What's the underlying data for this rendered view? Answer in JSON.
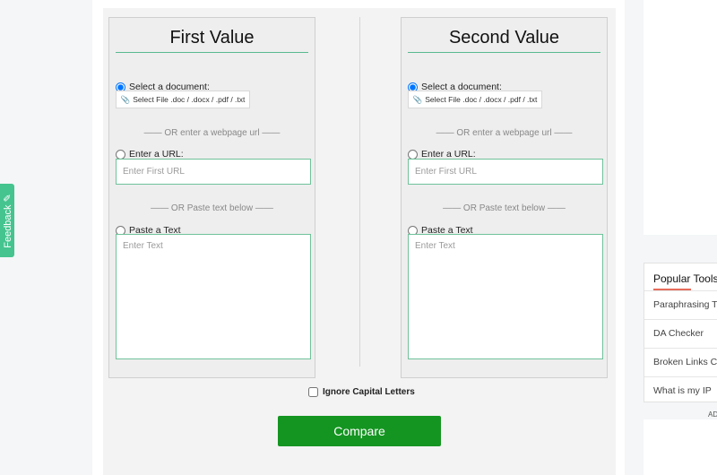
{
  "feedback": {
    "label": "Feedback"
  },
  "first": {
    "title": "First Value",
    "select_doc_label": "Select a document:",
    "file_button_label": "Select File .doc / .docx / .pdf / .txt",
    "or_url_text": "—— OR enter a webpage url ——",
    "url_label": "Enter a URL:",
    "url_placeholder": "Enter First URL",
    "or_paste_text": "—— OR Paste text below ——",
    "paste_label": "Paste a Text",
    "text_placeholder": "Enter Text"
  },
  "second": {
    "title": "Second Value",
    "select_doc_label": "Select a document:",
    "file_button_label": "Select File .doc / .docx / .pdf / .txt",
    "or_url_text": "—— OR enter a webpage url ——",
    "url_label": "Enter a URL:",
    "url_placeholder": "Enter First URL",
    "or_paste_text": "—— OR Paste text below ——",
    "paste_label": "Paste a Text",
    "text_placeholder": "Enter Text"
  },
  "options": {
    "ignore_caps_label": "Ignore Capital Letters"
  },
  "actions": {
    "compare_label": "Compare"
  },
  "popular_tools": {
    "title": "Popular Tools",
    "items": [
      "Paraphrasing T",
      "DA Checker",
      "Broken Links C",
      "What is my IP"
    ]
  },
  "ad": {
    "label": "AD"
  },
  "colors": {
    "accent_green": "#149521",
    "feedback_green": "#45c48f",
    "underline_red": "#e76b5b"
  }
}
